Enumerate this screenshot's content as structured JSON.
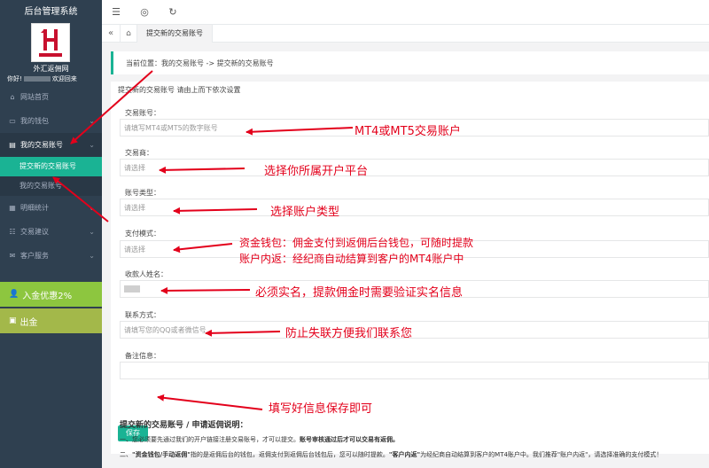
{
  "app": {
    "system_title": "后台管理系统",
    "site_name": "外汇返佣网",
    "welcome_prefix": "你好!",
    "welcome_suffix": "欢迎回来"
  },
  "sidebar": {
    "items": [
      {
        "label": "网站首页",
        "icon": "home-icon"
      },
      {
        "label": "我的钱包",
        "icon": "wallet-icon"
      },
      {
        "label": "我的交易账号",
        "icon": "account-icon"
      },
      {
        "label": "明细统计",
        "icon": "stats-icon"
      },
      {
        "label": "交易建议",
        "icon": "advice-icon"
      },
      {
        "label": "客户服务",
        "icon": "service-icon"
      }
    ],
    "sub_items": [
      "提交新的交易账号",
      "我的交易账号"
    ],
    "promo_deposit": "入金优惠2%",
    "promo_withdraw": "出金"
  },
  "tabs": {
    "active_tab": "提交新的交易账号"
  },
  "breadcrumb": "当前位置：我的交易账号 -> 提交新的交易账号",
  "form": {
    "heading": "提交新的交易账号 请由上而下依次设置",
    "fields": [
      {
        "label": "交易账号：",
        "placeholder": "请填写MT4或MT5的数字账号"
      },
      {
        "label": "交易商：",
        "placeholder": "请选择"
      },
      {
        "label": "账号类型：",
        "placeholder": "请选择"
      },
      {
        "label": "支付模式：",
        "placeholder": "请选择"
      },
      {
        "label": "收款人姓名：",
        "placeholder": ""
      },
      {
        "label": "联系方式：",
        "placeholder": "请填写您的QQ或者微信号"
      },
      {
        "label": "备注信息：",
        "placeholder": ""
      }
    ],
    "save_label": "保存"
  },
  "notes": {
    "title": "提交新的交易账号 / 申请返佣说明：",
    "line1_a": "一、您必须要先通过我们的开户链接注册交易账号，才可以提交。",
    "line1_b": "账号审核通过后才可以交易有返佣。",
    "line2_a": "二、",
    "line2_b": "\"资金钱包/手动返佣\"",
    "line2_c": "指的是返佣后台的钱包，返佣支付到返佣后台钱包后，您可以随时提款。",
    "line2_d": "\"客户内返\"",
    "line2_e": "为经纪商自动结算到客户的MT4账户中。我们推荐\"账户内返\"，请选择准确的支付模式！"
  },
  "annotations": {
    "a1": "MT4或MT5交易账户",
    "a2": "选择你所属开户平台",
    "a3": "选择账户类型",
    "a4_line1": "资金钱包：佣金支付到返佣后台钱包，可随时提款",
    "a4_line2": "账户内返：经纪商自动结算到客户的MT4账户中",
    "a5": "必须实名，提款佣金时需要验证实名信息",
    "a6": "防止失联方便我们联系您",
    "a7": "填写好信息保存即可"
  },
  "colors": {
    "sidebar_bg": "#2f4050",
    "accent": "#1ab394",
    "annotation_red": "#e3001b",
    "promo_green": "#8dc63f"
  }
}
